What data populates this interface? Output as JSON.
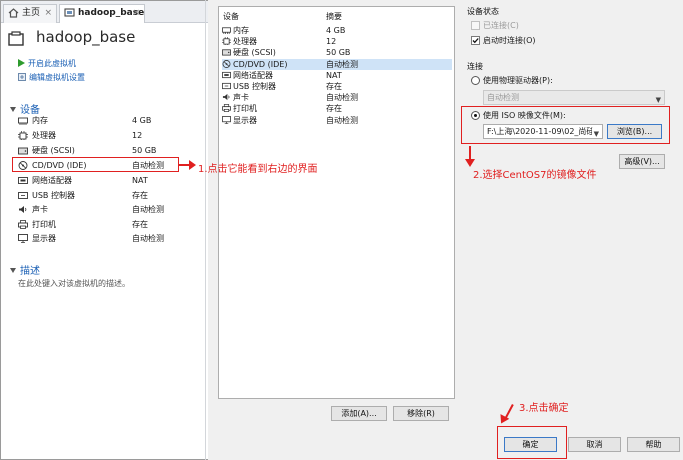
{
  "tabs": [
    {
      "label": "主页"
    },
    {
      "label": "hadoop_base",
      "close": "×"
    }
  ],
  "home_close": "×",
  "vm": {
    "title": "hadoop_base",
    "actions": [
      "开启此虚拟机",
      "编辑虚拟机设置"
    ]
  },
  "devices_section": {
    "title": "设备",
    "rows": [
      {
        "name": "内存",
        "value": "4 GB",
        "icon": "memory-icon"
      },
      {
        "name": "处理器",
        "value": "12",
        "icon": "cpu-icon"
      },
      {
        "name": "硬盘 (SCSI)",
        "value": "50 GB",
        "icon": "harddisk-icon"
      },
      {
        "name": "CD/DVD (IDE)",
        "value": "自动检测",
        "icon": "cd-icon"
      },
      {
        "name": "网络适配器",
        "value": "NAT",
        "icon": "network-icon"
      },
      {
        "name": "USB 控制器",
        "value": "存在",
        "icon": "usb-icon"
      },
      {
        "name": "声卡",
        "value": "自动检测",
        "icon": "sound-icon"
      },
      {
        "name": "打印机",
        "value": "存在",
        "icon": "printer-icon"
      },
      {
        "name": "显示器",
        "value": "自动检测",
        "icon": "display-icon"
      }
    ]
  },
  "description_section": {
    "title": "描述",
    "placeholder": "在此处键入对该虚拟机的描述。"
  },
  "dialog": {
    "list_headers": {
      "device": "设备",
      "summary": "摘要"
    },
    "list_rows": [
      {
        "name": "内存",
        "value": "4 GB"
      },
      {
        "name": "处理器",
        "value": "12"
      },
      {
        "name": "硬盘 (SCSI)",
        "value": "50 GB"
      },
      {
        "name": "CD/DVD (IDE)",
        "value": "自动检测"
      },
      {
        "name": "网络适配器",
        "value": "NAT"
      },
      {
        "name": "USB 控制器",
        "value": "存在"
      },
      {
        "name": "声卡",
        "value": "自动检测"
      },
      {
        "name": "打印机",
        "value": "存在"
      },
      {
        "name": "显示器",
        "value": "自动检测"
      }
    ],
    "selected_row": 3,
    "add_button": "添加(A)...",
    "remove_button": "移除(R)",
    "device_status": {
      "title": "设备状态",
      "connected": "已连接(C)",
      "connected_checked": false,
      "connect_on_power": "启动时连接(O)",
      "connect_on_power_checked": true
    },
    "connection": {
      "title": "连接",
      "physical_drive": "使用物理驱动器(P):",
      "physical_drive_value": "自动检测",
      "iso_image": "使用 ISO 映像文件(M):",
      "iso_path": "F:\\上海\\2020-11-09\\02_尚硅",
      "browse_button": "浏览(B)...",
      "selected": "iso"
    },
    "advanced_button": "高级(V)...",
    "ok_button": "确定",
    "cancel_button": "取消",
    "help_button": "帮助"
  },
  "annotations": {
    "step1": "1.点击它能看到右边的界面",
    "step2": "2.选择CentOS7的镜像文件",
    "step3": "3.点击确定"
  },
  "colors": {
    "annotation": "#e02020",
    "link": "#1a5fb4",
    "selection": "#cfe3f7"
  }
}
